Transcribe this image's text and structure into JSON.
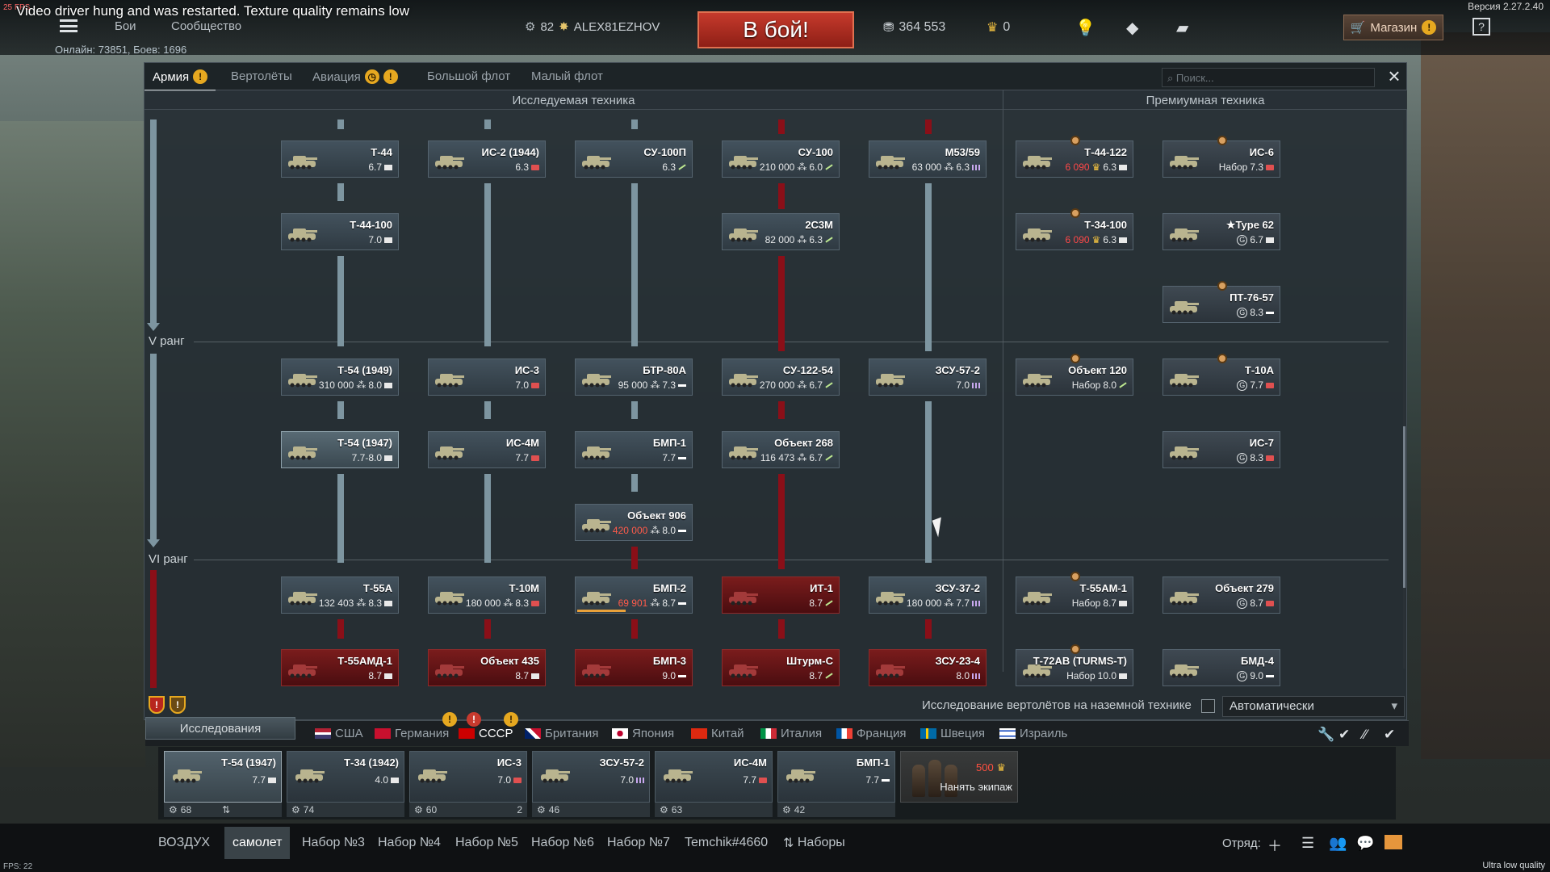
{
  "topbar": {
    "fps": "25 FPS",
    "warning": "Video driver hung and was restarted. Texture quality remains low",
    "version": "Версия 2.27.2.40",
    "menu": [
      "Бои",
      "Сообщество"
    ],
    "online": "Онлайн: 73851, Боев: 1696",
    "player_level": "82",
    "player_name": "ALEX81EZHOV",
    "battle_button": "В бой!",
    "silver": "364 553",
    "gold": "0",
    "shop_label": "Магазин",
    "help": "?"
  },
  "panel": {
    "tabs": [
      {
        "label": "Армия",
        "active": true
      },
      {
        "label": "Вертолёты",
        "active": false
      },
      {
        "label": "Авиация",
        "active": false
      },
      {
        "label": "Большой флот",
        "active": false
      },
      {
        "label": "Малый флот",
        "active": false
      }
    ],
    "search_placeholder": "Поиск...",
    "col_research": "Исследуемая техника",
    "col_premium": "Премиумная техника",
    "rank5": "V ранг",
    "rank6": "VI ранг"
  },
  "tree": [
    {
      "name": "Т-44",
      "info": "6.7",
      "tag": "med",
      "state": "normal"
    },
    {
      "name": "ИС-2 (1944)",
      "info": "6.3",
      "tag": "heavy",
      "state": "normal"
    },
    {
      "name": "СУ-100П",
      "info": "6.3",
      "tag": "td",
      "state": "normal"
    },
    {
      "name": "СУ-100",
      "info": "210 000 · 6.0",
      "tag": "td",
      "state": "normal"
    },
    {
      "name": "M53/59",
      "info": "63 000 · 6.3",
      "tag": "spaa",
      "state": "normal"
    },
    {
      "name": "Т-44-100",
      "info": "7.0",
      "tag": "med",
      "state": "normal"
    },
    {
      "name": "2С3М",
      "info": "82 000 · 6.3",
      "tag": "td",
      "state": "normal"
    },
    {
      "name": "Т-54 (1949)",
      "info": "310 000 · 8.0",
      "tag": "med",
      "state": "normal"
    },
    {
      "name": "ИС-3",
      "info": "7.0",
      "tag": "heavy",
      "state": "normal"
    },
    {
      "name": "БТР-80А",
      "info": "95 000 · 7.3",
      "tag": "light",
      "state": "normal"
    },
    {
      "name": "СУ-122-54",
      "info": "270 000 · 6.7",
      "tag": "td",
      "state": "normal"
    },
    {
      "name": "ЗСУ-57-2",
      "info": "7.0",
      "tag": "spaa",
      "state": "normal"
    },
    {
      "name": "Т-54 (1947)",
      "info": "7.7-8.0",
      "tag": "med",
      "state": "own"
    },
    {
      "name": "ИС-4М",
      "info": "7.7",
      "tag": "heavy",
      "state": "normal"
    },
    {
      "name": "БМП-1",
      "info": "7.7",
      "tag": "light",
      "state": "normal"
    },
    {
      "name": "Объект 268",
      "info": "116 473 · 6.7",
      "tag": "td",
      "state": "normal"
    },
    {
      "name": "Объект 906",
      "info": "420 000 · 8.0",
      "tag": "light",
      "state": "normal"
    },
    {
      "name": "Т-55А",
      "info": "132 403 · 8.3",
      "tag": "med",
      "state": "normal"
    },
    {
      "name": "Т-10М",
      "info": "180 000 · 8.3",
      "tag": "heavy",
      "state": "normal"
    },
    {
      "name": "БМП-2",
      "info": "69 901 · 8.7",
      "tag": "light",
      "state": "normal"
    },
    {
      "name": "ИТ-1",
      "info": "8.7",
      "tag": "td",
      "state": "locked"
    },
    {
      "name": "ЗСУ-37-2",
      "info": "180 000 · 7.7",
      "tag": "spaa",
      "state": "normal"
    },
    {
      "name": "Т-55АМД-1",
      "info": "8.7",
      "tag": "med",
      "state": "locked"
    },
    {
      "name": "Объект 435",
      "info": "8.7",
      "tag": "med",
      "state": "locked"
    },
    {
      "name": "БМП-3",
      "info": "9.0",
      "tag": "light",
      "state": "locked"
    },
    {
      "name": "Штурм-С",
      "info": "8.7",
      "tag": "td",
      "state": "locked"
    },
    {
      "name": "ЗСУ-23-4",
      "info": "8.0",
      "tag": "spaa",
      "state": "locked"
    }
  ],
  "tree_costs": {
    "su100": "210 000",
    "m53": "63 000",
    "s2s3m": "82 000",
    "t54_49": "310 000",
    "btr80": "95 000",
    "su122": "270 000",
    "ob268": "116 473",
    "ob906": "420 000",
    "t55a": "132 403",
    "t10m": "180 000",
    "bmp2": "69 901",
    "zsu372": "180 000"
  },
  "premium": [
    {
      "name": "Т-44-122",
      "cost": "6 090",
      "br": "6.3"
    },
    {
      "name": "ИС-6",
      "cost": "Набор",
      "br": "7.3"
    },
    {
      "name": "Т-34-100",
      "cost": "6 090",
      "br": "6.3"
    },
    {
      "name": "★Type 62",
      "cost": "",
      "br": "6.7"
    },
    {
      "name": "ПТ-76-57",
      "cost": "",
      "br": "8.3"
    },
    {
      "name": "Объект 120",
      "cost": "Набор",
      "br": "8.0"
    },
    {
      "name": "Т-10А",
      "cost": "",
      "br": "7.7"
    },
    {
      "name": "ИС-7",
      "cost": "",
      "br": "8.3"
    },
    {
      "name": "Т-55АМ-1",
      "cost": "Набор",
      "br": "8.7"
    },
    {
      "name": "Объект 279",
      "cost": "",
      "br": "8.7"
    },
    {
      "name": "Т-72АВ (TURMS-T)",
      "cost": "Набор",
      "br": "10.0"
    },
    {
      "name": "БМД-4",
      "cost": "",
      "br": "9.0"
    }
  ],
  "controls": {
    "research_label": "Исследования",
    "heli_research": "Исследование вертолётов на наземной технике",
    "dropdown_value": "Автоматически"
  },
  "nations": [
    {
      "label": "США",
      "active": false
    },
    {
      "label": "Германия",
      "active": false
    },
    {
      "label": "СССР",
      "active": true
    },
    {
      "label": "Британия",
      "active": false
    },
    {
      "label": "Япония",
      "active": false
    },
    {
      "label": "Китай",
      "active": false
    },
    {
      "label": "Италия",
      "active": false
    },
    {
      "label": "Франция",
      "active": false
    },
    {
      "label": "Швеция",
      "active": false
    },
    {
      "label": "Израиль",
      "active": false
    }
  ],
  "crew": [
    {
      "name": "Т-54 (1947)",
      "br": "7.7",
      "count": "68",
      "tag": "med"
    },
    {
      "name": "Т-34 (1942)",
      "br": "4.0",
      "count": "74",
      "tag": "med"
    },
    {
      "name": "ИС-3",
      "br": "7.0",
      "count": "60",
      "tag": "heavy",
      "extra": "2"
    },
    {
      "name": "ЗСУ-57-2",
      "br": "7.0",
      "count": "46",
      "tag": "spaa"
    },
    {
      "name": "ИС-4М",
      "br": "7.7",
      "count": "63",
      "tag": "heavy"
    },
    {
      "name": "БМП-1",
      "br": "7.7",
      "count": "42",
      "tag": "light"
    }
  ],
  "hire": {
    "cost": "500",
    "label": "Нанять экипаж"
  },
  "presets": [
    "ВОЗДУХ",
    "самолет",
    "Набор №3",
    "Набор №4",
    "Набор №5",
    "Набор №6",
    "Набор №7",
    "Temchik#4660"
  ],
  "presets_label": "Наборы",
  "squad_label": "Отряд:",
  "fps_bottom": "FPS: 22",
  "quality": "Ultra low quality",
  "colors": {
    "accent_red": "#8a0f18",
    "line": "#7d95a0",
    "battle": "#c63a2c"
  }
}
